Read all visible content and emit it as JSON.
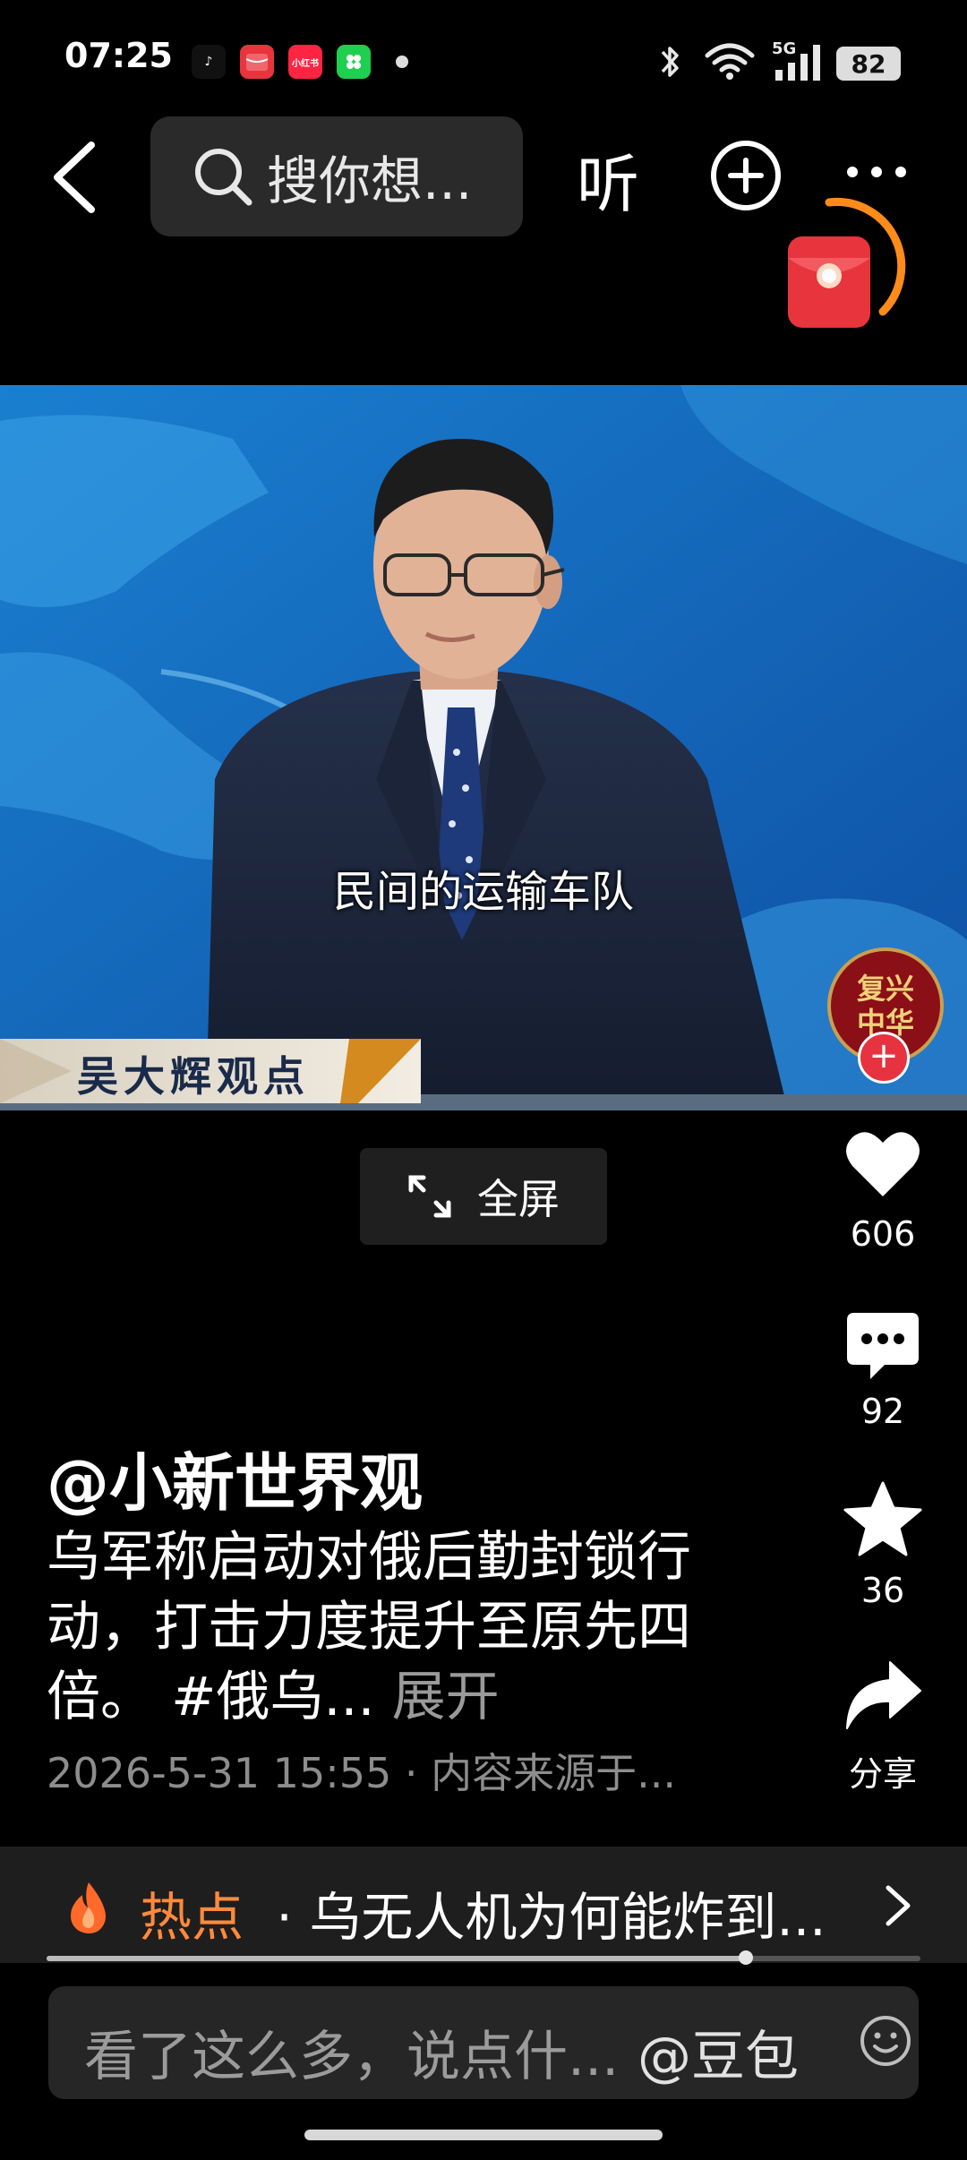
{
  "status_bar": {
    "time": "07:25",
    "network": "5G",
    "battery": "82",
    "app_icons": [
      {
        "name": "tiktok",
        "label": "♪",
        "color": "#111111"
      },
      {
        "name": "red-packet",
        "label": "",
        "color": "#e8343c"
      },
      {
        "name": "xiaohongshu",
        "label": "小红书",
        "color": "#ff2442"
      },
      {
        "name": "wechat-mini",
        "label": "",
        "color": "#1fcf4f"
      }
    ]
  },
  "top_bar": {
    "search_placeholder": "搜你想...",
    "listen_label": "听"
  },
  "video": {
    "subtitle": "民间的运输车队",
    "lower_third": "吴大辉观点",
    "channel_badge": "复兴中华"
  },
  "fullscreen_label": "全屏",
  "actions": {
    "likes": "606",
    "comments": "92",
    "favorites": "36",
    "share_label": "分享"
  },
  "post": {
    "author": "@小新世界观",
    "description": "乌军称启动对俄后勤封锁行动，打击力度提升至原先四倍。 #俄乌...",
    "expand_label": "展开",
    "meta": "2026-5-31 15:55 · 内容来源于..."
  },
  "hot": {
    "label": "热点",
    "separator": " · ",
    "text": "乌无人机为何能炸到...",
    "progress": 0.8
  },
  "comment_bar": {
    "placeholder": "看了这么多，说点什...",
    "mention": "@豆包"
  },
  "colors": {
    "accent_orange": "#ff8a3d",
    "like_red": "#e7323f"
  }
}
